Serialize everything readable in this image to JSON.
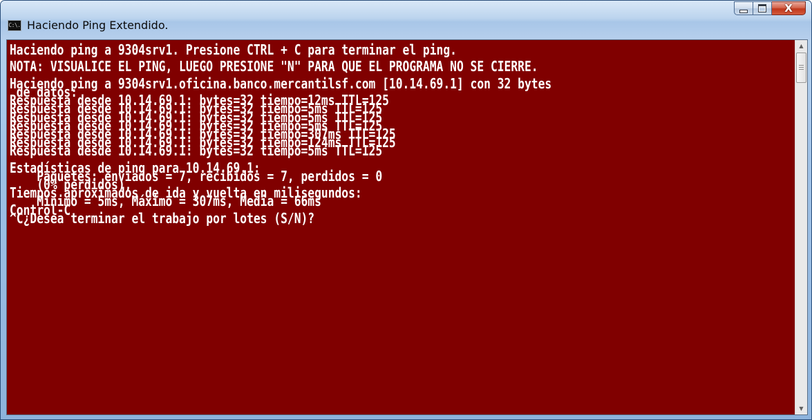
{
  "window": {
    "title": "Haciendo Ping Extendido.",
    "icon_label": "C:\\.",
    "icon_name": "console-app-icon",
    "controls": {
      "minimize": "minimize-icon",
      "maximize": "maximize-icon",
      "close_glyph": "X"
    }
  },
  "console": {
    "background_color": "#800000",
    "text_color": "#ffffff",
    "lines": [
      "Haciendo ping a 9304srv1. Presione CTRL + C para terminar el ping.",
      "",
      "NOTA: VISUALICE EL PING, LUEGO PRESIONE \"N\" PARA QUE EL PROGRAMA NO SE CIERRE.",
      "",
      "Haciendo ping a 9304srv1.oficina.banco.mercantilsf.com [10.14.69.1] con 32 bytes",
      " de datos:",
      "Respuesta desde 10.14.69.1: bytes=32 tiempo=12ms TTL=125",
      "Respuesta desde 10.14.69.1: bytes=32 tiempo=5ms TTL=125",
      "Respuesta desde 10.14.69.1: bytes=32 tiempo=5ms TTL=125",
      "Respuesta desde 10.14.69.1: bytes=32 tiempo=5ms TTL=125",
      "Respuesta desde 10.14.69.1: bytes=32 tiempo=307ms TTL=125",
      "Respuesta desde 10.14.69.1: bytes=32 tiempo=124ms TTL=125",
      "Respuesta desde 10.14.69.1: bytes=32 tiempo=5ms TTL=125",
      "",
      "Estadísticas de ping para 10.14.69.1:",
      "    Paquetes: enviados = 7, recibidos = 7, perdidos = 0",
      "    (0% perdidos),",
      "Tiempos aproximados de ida y vuelta en milisegundos:",
      "    Mínimo = 5ms, Máximo = 307ms, Media = 66ms",
      "Control-C",
      "^C¿Desea terminar el trabajo por lotes (S/N)?"
    ]
  },
  "scrollbar": {
    "up_arrow": "▲",
    "down_arrow": "▼"
  }
}
